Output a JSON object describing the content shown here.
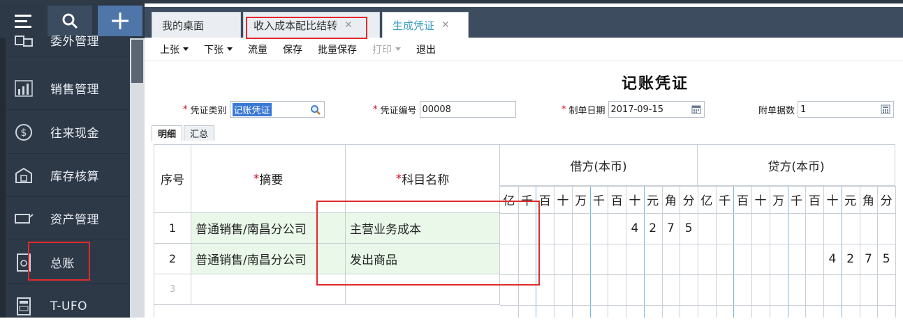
{
  "sidebar": {
    "items": [
      {
        "label": "委外管理",
        "icon": "outsourcing-icon"
      },
      {
        "label": "销售管理",
        "icon": "sales-chart-icon"
      },
      {
        "label": "往来现金",
        "icon": "cash-icon"
      },
      {
        "label": "库存核算",
        "icon": "inventory-icon"
      },
      {
        "label": "资产管理",
        "icon": "asset-icon"
      },
      {
        "label": "总账",
        "icon": "ledger-icon"
      },
      {
        "label": "T-UFO",
        "icon": "ufo-report-icon"
      }
    ]
  },
  "tabs": [
    {
      "label": "我的桌面",
      "closable": false
    },
    {
      "label": "收入成本配比结转",
      "closable": true
    },
    {
      "label": "生成凭证",
      "closable": true
    }
  ],
  "toolbar": {
    "prev": "上张",
    "next": "下张",
    "flow": "流量",
    "save": "保存",
    "batch_save": "批量保存",
    "print": "打印",
    "exit": "退出"
  },
  "voucher": {
    "title": "记账凭证",
    "type_label": "凭证类别",
    "type_value": "记账凭证",
    "number_label": "凭证编号",
    "number_value": "00008",
    "date_label": "制单日期",
    "date_value": "2017-09-15",
    "attachments_label": "附单据数",
    "attachments_value": "1"
  },
  "subtabs": [
    "明细",
    "汇总"
  ],
  "grid": {
    "col_seq": "序号",
    "col_summary": "摘要",
    "col_account": "科目名称",
    "col_debit": "借方(本币)",
    "col_credit": "贷方(本币)",
    "units": [
      "亿",
      "千",
      "百",
      "十",
      "万",
      "千",
      "百",
      "十",
      "元",
      "角",
      "分"
    ],
    "rows": [
      {
        "seq": "1",
        "summary": "普通销售/南昌分公司",
        "account": "主营业务成本",
        "debit_digits": [
          "4",
          "2",
          "7",
          "5"
        ],
        "credit_digits": []
      },
      {
        "seq": "2",
        "summary": "普通销售/南昌分公司",
        "account": "发出商品",
        "debit_digits": [],
        "credit_digits": [
          "4",
          "2",
          "7",
          "5"
        ]
      },
      {
        "seq": "3",
        "summary": "",
        "account": "",
        "debit_digits": [],
        "credit_digits": []
      }
    ]
  },
  "colors": {
    "sidebar_bg": "#2e3948",
    "active_tab": "#3a9ec6",
    "highlight_box": "#e02a2a",
    "row_green": "#e9f8e9"
  }
}
